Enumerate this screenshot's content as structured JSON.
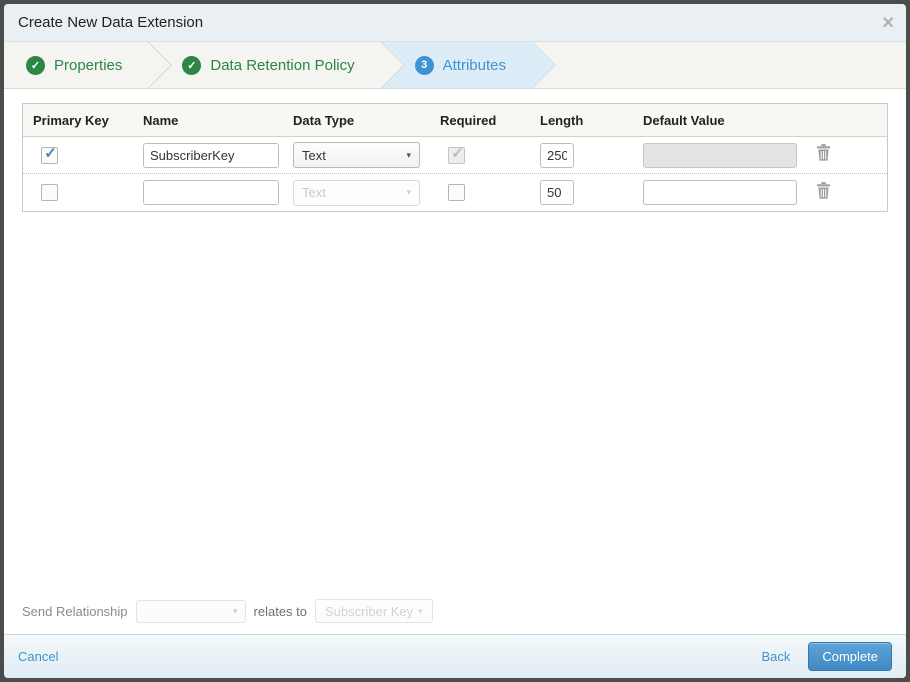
{
  "dialog": {
    "title": "Create New Data Extension",
    "close_glyph": "×"
  },
  "wizard": {
    "check_glyph": "✓",
    "steps": [
      {
        "label": "Properties",
        "glyph": "✓",
        "status": "complete"
      },
      {
        "label": "Data Retention Policy",
        "glyph": "✓",
        "status": "complete"
      },
      {
        "label": "Attributes",
        "glyph": "3",
        "status": "active"
      }
    ]
  },
  "table": {
    "check_glyph": "✓",
    "headers": {
      "primary_key": "Primary Key",
      "name": "Name",
      "data_type": "Data Type",
      "required": "Required",
      "length": "Length",
      "default_value": "Default Value"
    },
    "rows": [
      {
        "primary_key_checked": "true",
        "name_value": "SubscriberKey",
        "data_type_value": "Text",
        "required_checked": "true",
        "length_value": "250",
        "default_value": ""
      },
      {
        "primary_key_checked": "false",
        "name_value": "",
        "data_type_value": "Text",
        "required_checked": "false",
        "length_value": "50",
        "default_value": ""
      }
    ]
  },
  "send_relationship": {
    "label": "Send Relationship",
    "relates_to": "relates to",
    "target": "Subscriber Key",
    "caret_glyph": "▾"
  },
  "footer": {
    "cancel": "Cancel",
    "back": "Back",
    "complete": "Complete"
  },
  "colors": {
    "success_green": "#2d8645",
    "accent_blue": "#3e93d1",
    "active_step_bg": "#dcedf8",
    "footer_bg": "#e8f1f7"
  }
}
